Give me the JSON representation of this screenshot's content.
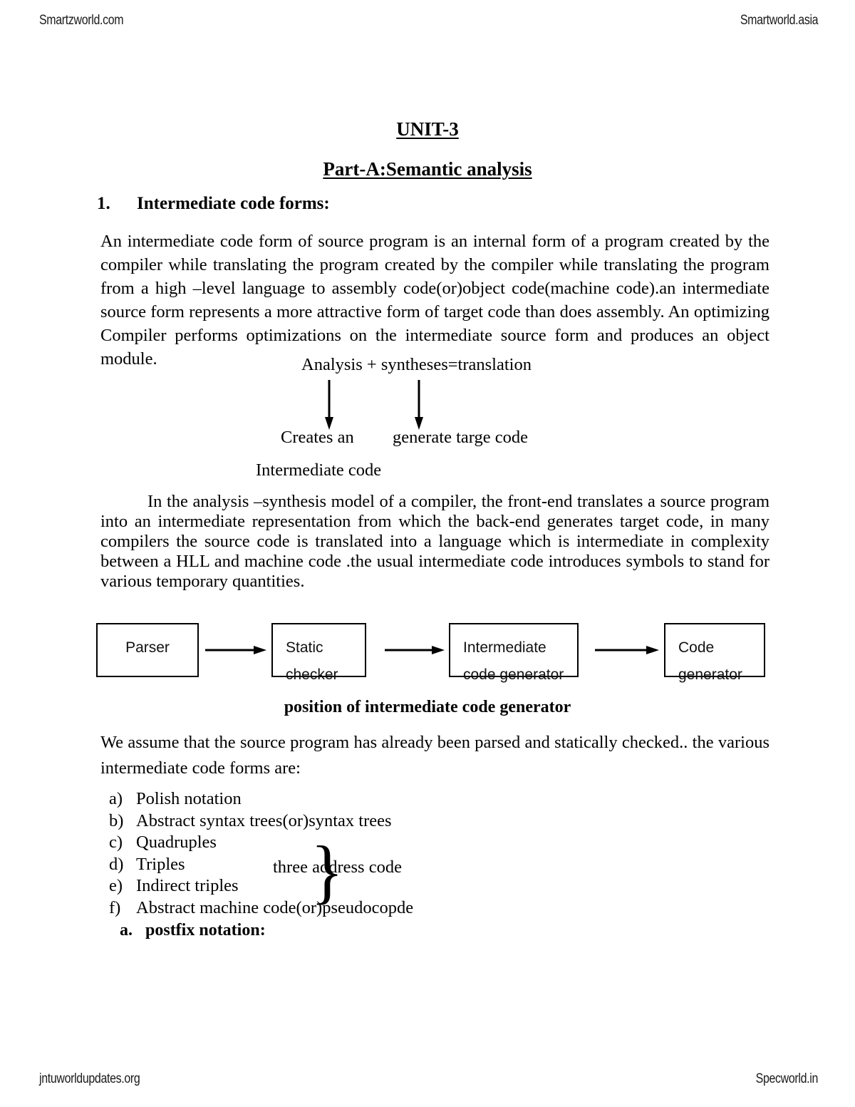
{
  "running_head": {
    "left": "Smartzworld.com",
    "right": "Smartworld.asia"
  },
  "running_foot": {
    "left": "jntuworldupdates.org",
    "right": "Specworld.in"
  },
  "headings": {
    "unit_title": "UNIT-3",
    "part_title": "Part-A:Semantic analysis",
    "section_number": "1.",
    "section_title": "Intermediate code forms:"
  },
  "paragraphs": {
    "p1": "An intermediate code form of source program is an internal form of a program created by the compiler while translating the program created by the compiler  while translating the program from a high –level language to assembly code(or)object code(machine code).an intermediate source form represents a more attractive form of target code than does assembly. An optimizing Compiler performs optimizations on the intermediate source form and produces an object module.",
    "p2": "In the analysis –synthesis model of a compiler, the front-end translates a source program into an intermediate representation from which the back-end generates target code, in many compilers the source code is translated into a language which is intermediate in complexity between a HLL and machine code .the usual intermediate code introduces symbols to stand for various temporary quantities.",
    "p3": "We assume that the source program has already been parsed and statically checked.. the various intermediate code forms are:"
  },
  "translation_diagram": {
    "equation": "Analysis + syntheses=translation",
    "left_label": "Creates an",
    "right_label": "generate targe code",
    "left_sublabel": "Intermediate code"
  },
  "flowchart": {
    "caption": "position of intermediate code generator",
    "boxes": [
      {
        "line1": "Parser",
        "line2": ""
      },
      {
        "line1": "Static",
        "line2": "checker"
      },
      {
        "line1": "Intermediate",
        "line2": "code generator"
      },
      {
        "line1": "Code",
        "line2": "generator"
      }
    ]
  },
  "code_forms_list": [
    {
      "marker": "a)",
      "text": "Polish  notation"
    },
    {
      "marker": "b)",
      "text": "Abstract syntax trees(or)syntax trees"
    },
    {
      "marker": "c)",
      "text": "Quadruples"
    },
    {
      "marker": "d)",
      "text": "Triples"
    },
    {
      "marker": "e)",
      "text": "Indirect triples"
    },
    {
      "marker": "f)",
      "text": "Abstract machine code(or)pseudocopde"
    }
  ],
  "brace_annotation": {
    "label": "three address code",
    "glyph": "}"
  },
  "sub_item": {
    "marker": "a.",
    "text": "postfix notation:"
  }
}
